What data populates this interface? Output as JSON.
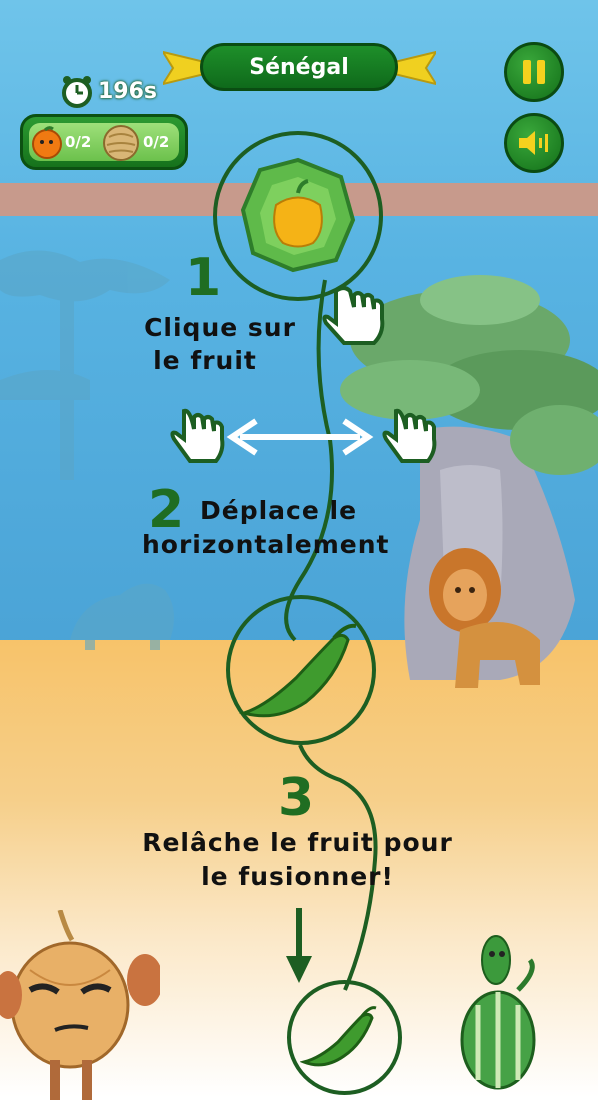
{
  "header": {
    "level_title": "Sénégal",
    "timer": "196s"
  },
  "counters": [
    {
      "icon": "orange-icon",
      "value": "0/2"
    },
    {
      "icon": "coconut-icon",
      "value": "0/2"
    }
  ],
  "controls": {
    "pause_icon": "pause-icon",
    "sound_icon": "speaker-icon"
  },
  "tutorial": {
    "step1_num": "1",
    "step1_line1": "Clique sur",
    "step1_line2": "le fruit",
    "step2_num": "2",
    "step2_line1": "Déplace le",
    "step2_line2": "horizontalement",
    "step3_num": "3",
    "step3_line1": "Relâche le fruit pour",
    "step3_line2": "le fusionner!"
  },
  "colors": {
    "accent_green": "#1f6d22",
    "sky": "#58b3e2",
    "sand": "#f6cf8a"
  }
}
